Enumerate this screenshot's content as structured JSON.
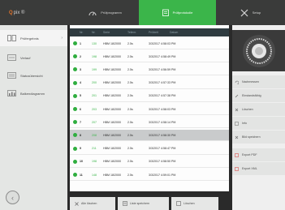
{
  "app": {
    "logo_q": "Q",
    "logo_rest": "pix ®"
  },
  "tabs": [
    {
      "label": "Prüfprogramm",
      "icon": "gauge-icon"
    },
    {
      "label": "Prüfprotokolle",
      "icon": "clipboard-icon"
    },
    {
      "label": "Setup",
      "icon": "tools-icon"
    }
  ],
  "sidebar": {
    "items": [
      {
        "label": "Prüfergebnis",
        "icon": "results-icon"
      },
      {
        "label": "Verlauf",
        "icon": "history-icon"
      },
      {
        "label": "Statusübersicht",
        "icon": "status-icon"
      },
      {
        "label": "Balkendiagramm",
        "icon": "bar-chart-icon"
      }
    ],
    "back_label": "‹"
  },
  "table": {
    "headers": [
      "Nr.",
      "Nr.",
      "Serie",
      "Teilenr.",
      "Prüfzeit",
      "Datum"
    ],
    "rows": [
      {
        "nr": "1",
        "id": "130",
        "tag": "HBM 18/2000",
        "dur": "2.5s",
        "date": "3/3/2017 4:58:03 PM"
      },
      {
        "nr": "2",
        "id": "198",
        "tag": "HBM 18/2000",
        "dur": "2.5s",
        "date": "3/3/2017 4:58:49 PM"
      },
      {
        "nr": "3",
        "id": "199",
        "tag": "HBM 18/2000",
        "dur": "2.5s",
        "date": "3/3/2017 4:56:59 PM"
      },
      {
        "nr": "4",
        "id": "200",
        "tag": "HBM 18/2000",
        "dur": "2.5s",
        "date": "3/3/2017 4:57:33 PM"
      },
      {
        "nr": "5",
        "id": "201",
        "tag": "HBM 18/2000",
        "dur": "2.5s",
        "date": "3/3/2017 4:57:38 PM"
      },
      {
        "nr": "6",
        "id": "203",
        "tag": "HBM 18/2000",
        "dur": "2.5s",
        "date": "3/3/2017 4:58:03 PM"
      },
      {
        "nr": "7",
        "id": "207",
        "tag": "HBM 18/2000",
        "dur": "2.5s",
        "date": "3/3/2017 4:58:14 PM"
      },
      {
        "nr": "8",
        "id": "208",
        "tag": "HBM 18/2000",
        "dur": "2.5s",
        "date": "3/3/2017 4:58:30 PM"
      },
      {
        "nr": "9",
        "id": "211",
        "tag": "HBM 18/2000",
        "dur": "2.5s",
        "date": "3/3/2017 4:58:47 PM"
      },
      {
        "nr": "10",
        "id": "198",
        "tag": "HBM 18/2000",
        "dur": "2.5s",
        "date": "3/3/2017 4:58:50 PM"
      },
      {
        "nr": "11",
        "id": "148",
        "tag": "HBM 18/2000",
        "dur": "2.5s",
        "date": "3/3/2017 4:59:01 PM"
      }
    ],
    "selected_row": 7
  },
  "bottom_buttons": [
    {
      "label": "Alle löschen",
      "icon": "close-icon"
    },
    {
      "label": "Liste speichern",
      "icon": "save-list-icon"
    },
    {
      "label": "Löschen",
      "icon": "delete-icon"
    }
  ],
  "right_panel": {
    "buttons": [
      {
        "label": "Nachmessen",
        "icon": "remeasure-icon"
      },
      {
        "label": "Einstandsfähig",
        "icon": "edit-icon"
      },
      {
        "label": "Löschen",
        "icon": "close-icon"
      },
      {
        "label": "Info",
        "icon": "info-icon"
      },
      {
        "label": "Bild speichern",
        "icon": "save-icon"
      },
      {
        "label": "Export PDF",
        "icon": "pdf-icon"
      },
      {
        "label": "Export XML",
        "icon": "xml-icon"
      }
    ]
  },
  "colors": {
    "accent": "#3bb54a",
    "topbar": "#3a3b3a",
    "status_ok": "#2fae3f"
  }
}
